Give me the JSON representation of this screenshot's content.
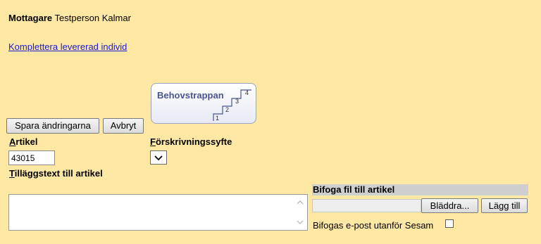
{
  "recipient": {
    "label": "Mottagare",
    "value": "Testperson Kalmar"
  },
  "complete_link": "Komplettera levererad individ",
  "stairs_logo": {
    "title": "Behovstrappan",
    "steps": [
      "1",
      "2",
      "3",
      "4"
    ]
  },
  "buttons": {
    "save": "Spara ändringarna",
    "cancel": "Avbryt"
  },
  "article": {
    "label_first": "A",
    "label_rest": "rtikel",
    "value": "43015"
  },
  "purpose": {
    "label_first": "F",
    "label_rest": "örskrivningssyfte",
    "selected": ""
  },
  "extra_text": {
    "label_first": "T",
    "label_rest": "illäggstext till artikel",
    "value": ""
  },
  "attach": {
    "header": "Bifoga fil till artikel",
    "browse": "Bläddra...",
    "add": "Lägg till",
    "email_label": "Bifogas e-post utanför Sesam"
  }
}
